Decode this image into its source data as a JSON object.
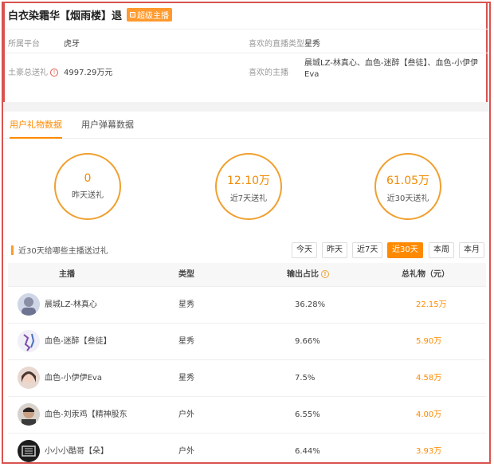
{
  "streamer": {
    "name": "白衣染霜华【烟雨楼】退",
    "badge": "超级主播"
  },
  "info": {
    "platform_label": "所属平台",
    "platform_value": "虎牙",
    "fav_type_label": "喜欢的直播类型",
    "fav_type_value": "星秀",
    "total_gift_label": "土豪总送礼",
    "total_gift_value": "4997.29万元",
    "fav_anchor_label": "喜欢的主播",
    "fav_anchor_value_line1": "晨城LZ-林真心、血色-迷醉【叁徒】、血色-小伊伊",
    "fav_anchor_value_line2": "Eva"
  },
  "tabs": [
    {
      "label": "用户礼物数据",
      "active": true
    },
    {
      "label": "用户弹幕数据",
      "active": false
    }
  ],
  "stats": [
    {
      "value": "0",
      "label": "昨天送礼"
    },
    {
      "value": "12.10万",
      "label": "近7天送礼"
    },
    {
      "value": "61.05万",
      "label": "近30天送礼"
    }
  ],
  "section_title": "近30天给哪些主播送过礼",
  "filters": [
    {
      "label": "今天",
      "active": false
    },
    {
      "label": "昨天",
      "active": false
    },
    {
      "label": "近7天",
      "active": false
    },
    {
      "label": "近30天",
      "active": true
    },
    {
      "label": "本周",
      "active": false
    },
    {
      "label": "本月",
      "active": false
    }
  ],
  "table": {
    "headers": {
      "anchor": "主播",
      "type": "类型",
      "ratio": "输出占比",
      "gift": "总礼物（元）"
    },
    "rows": [
      {
        "anchor": "晨城LZ-林真心",
        "type": "星秀",
        "ratio": "36.28%",
        "gift": "22.15万"
      },
      {
        "anchor": "血色-迷醉【叁徒】",
        "type": "星秀",
        "ratio": "9.66%",
        "gift": "5.90万"
      },
      {
        "anchor": "血色-小伊伊Eva",
        "type": "星秀",
        "ratio": "7.5%",
        "gift": "4.58万"
      },
      {
        "anchor": "血色-刘汞鸡【精神股东",
        "type": "户外",
        "ratio": "6.55%",
        "gift": "4.00万"
      },
      {
        "anchor": "小小小酷哥【朵】",
        "type": "户外",
        "ratio": "6.44%",
        "gift": "3.93万"
      }
    ]
  },
  "colors": {
    "accent": "#ff8a00",
    "highlight_border": "#d9534f"
  }
}
